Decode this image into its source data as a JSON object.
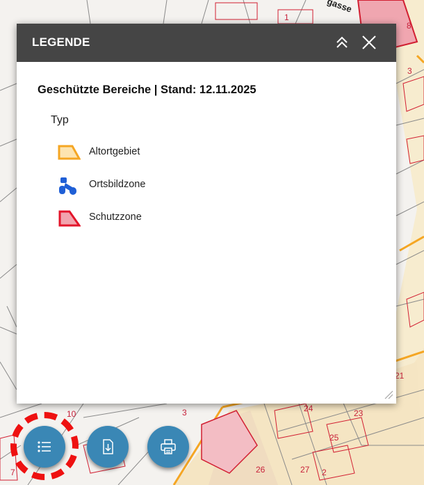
{
  "map": {
    "labels": [
      {
        "id": "l1",
        "text": "1"
      },
      {
        "id": "l8",
        "text": "8"
      },
      {
        "id": "l3a",
        "text": "3"
      },
      {
        "id": "lgasse",
        "text": "gasse"
      },
      {
        "id": "l10",
        "text": "10"
      },
      {
        "id": "l3b",
        "text": "3"
      },
      {
        "id": "l24",
        "text": "24"
      },
      {
        "id": "l23",
        "text": "23"
      },
      {
        "id": "l21",
        "text": "21"
      },
      {
        "id": "l25",
        "text": "25"
      },
      {
        "id": "l26",
        "text": "26"
      },
      {
        "id": "l27",
        "text": "27"
      },
      {
        "id": "l2",
        "text": "2"
      },
      {
        "id": "l7",
        "text": "7"
      }
    ]
  },
  "panel": {
    "title": "LEGENDE",
    "collapse_icon": "chevron-double-up-icon",
    "close_icon": "close-icon",
    "layer_title": "Geschützte Bereiche | Stand: 12.11.2025",
    "group_label": "Typ",
    "items": [
      {
        "label": "Altortgebiet",
        "icon": "orange-polygon-icon",
        "color": "#f5a623"
      },
      {
        "label": "Ortsbildzone",
        "icon": "blue-symbol-icon",
        "color": "#1f5fd6"
      },
      {
        "label": "Schutzzone",
        "icon": "red-polygon-icon",
        "color": "#e3152b"
      }
    ]
  },
  "toolbar": {
    "buttons": [
      {
        "name": "legend-button",
        "icon": "list-icon"
      },
      {
        "name": "download-button",
        "icon": "download-icon"
      },
      {
        "name": "print-button",
        "icon": "print-icon"
      }
    ],
    "accent": "#3a87b5",
    "highlight_color": "#ee1111"
  }
}
